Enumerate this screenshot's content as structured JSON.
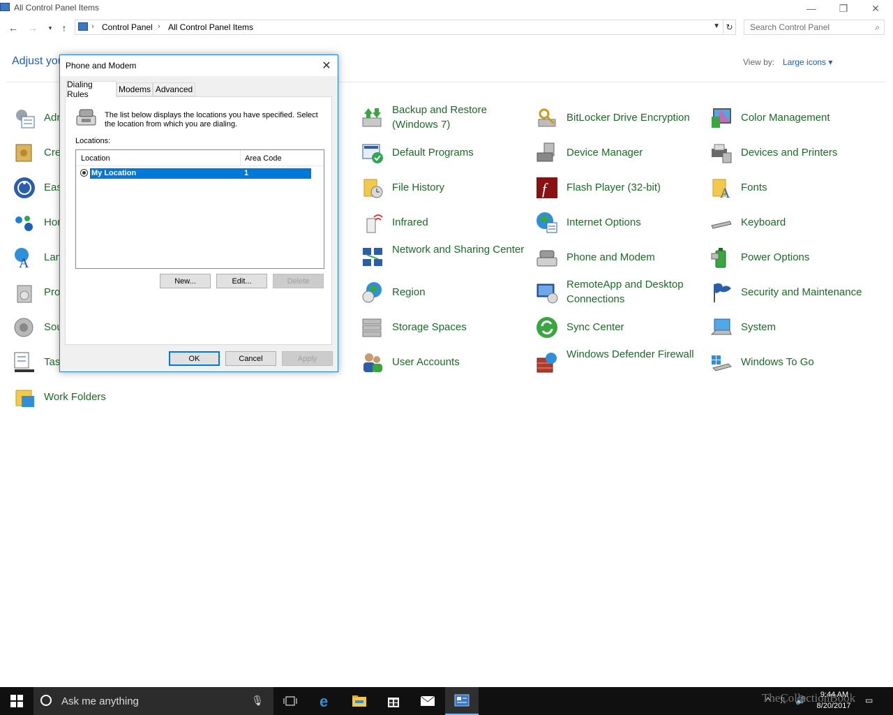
{
  "window": {
    "title": "All Control Panel Items",
    "minimize_glyph": "—",
    "restore_glyph": "❐",
    "close_glyph": "✕"
  },
  "address": {
    "breadcrumbs": [
      "Control Panel",
      "All Control Panel Items"
    ],
    "search_placeholder": "Search Control Panel"
  },
  "header": {
    "heading": "Adjust you",
    "view_by_label": "View by:",
    "view_by_value": "Large icons ▾"
  },
  "items": [
    {
      "label": "Adr",
      "icon": "admin-tools-icon"
    },
    {
      "label": "Cre",
      "icon": "credential-manager-icon"
    },
    {
      "label": "Eas",
      "icon": "ease-of-access-icon"
    },
    {
      "label": "Hor",
      "icon": "homegroup-icon"
    },
    {
      "label": "Lan",
      "icon": "language-icon"
    },
    {
      "label": "Pro",
      "icon": "programs-icon"
    },
    {
      "label": "Sou",
      "icon": "sound-icon"
    },
    {
      "label": "Tas",
      "icon": "taskbar-icon"
    },
    {
      "label": "Work Folders",
      "icon": "work-folders-icon"
    },
    {
      "label": "Backup and Restore (Windows 7)",
      "icon": "backup-restore-icon"
    },
    {
      "label": "Default Programs",
      "icon": "default-programs-icon"
    },
    {
      "label": "File History",
      "icon": "file-history-icon"
    },
    {
      "label": "Infrared",
      "icon": "infrared-icon"
    },
    {
      "label": "Network and Sharing Center",
      "icon": "network-sharing-icon"
    },
    {
      "label": "Region",
      "icon": "region-icon"
    },
    {
      "label": "Storage Spaces",
      "icon": "storage-spaces-icon"
    },
    {
      "label": "User Accounts",
      "icon": "user-accounts-icon"
    },
    {
      "label": "BitLocker Drive Encryption",
      "icon": "bitlocker-icon"
    },
    {
      "label": "Device Manager",
      "icon": "device-manager-icon"
    },
    {
      "label": "Flash Player (32-bit)",
      "icon": "flash-player-icon"
    },
    {
      "label": "Internet Options",
      "icon": "internet-options-icon"
    },
    {
      "label": "Phone and Modem",
      "icon": "phone-modem-icon"
    },
    {
      "label": "RemoteApp and Desktop Connections",
      "icon": "remoteapp-icon"
    },
    {
      "label": "Sync Center",
      "icon": "sync-center-icon"
    },
    {
      "label": "Windows Defender Firewall",
      "icon": "firewall-icon"
    },
    {
      "label": "Color Management",
      "icon": "color-management-icon"
    },
    {
      "label": "Devices and Printers",
      "icon": "devices-printers-icon"
    },
    {
      "label": "Fonts",
      "icon": "fonts-icon"
    },
    {
      "label": "Keyboard",
      "icon": "keyboard-icon"
    },
    {
      "label": "Power Options",
      "icon": "power-options-icon"
    },
    {
      "label": "Security and Maintenance",
      "icon": "security-maintenance-icon"
    },
    {
      "label": "System",
      "icon": "system-icon"
    },
    {
      "label": "Windows To Go",
      "icon": "windows-to-go-icon"
    }
  ],
  "dialog": {
    "title": "Phone and Modem",
    "tabs": [
      "Dialing Rules",
      "Modems",
      "Advanced"
    ],
    "intro": "The list below displays the locations you have specified. Select the location from which you are dialing.",
    "locations_label": "Locations:",
    "columns": [
      "Location",
      "Area Code"
    ],
    "rows": [
      {
        "location": "My Location",
        "area_code": "1"
      }
    ],
    "buttons": {
      "new": "New...",
      "edit": "Edit...",
      "delete": "Delete",
      "ok": "OK",
      "cancel": "Cancel",
      "apply": "Apply"
    }
  },
  "taskbar": {
    "search_text": "Ask me anything",
    "time": "9:44 AM",
    "date": "8/20/2017",
    "watermark": "TheCollectionBook"
  }
}
